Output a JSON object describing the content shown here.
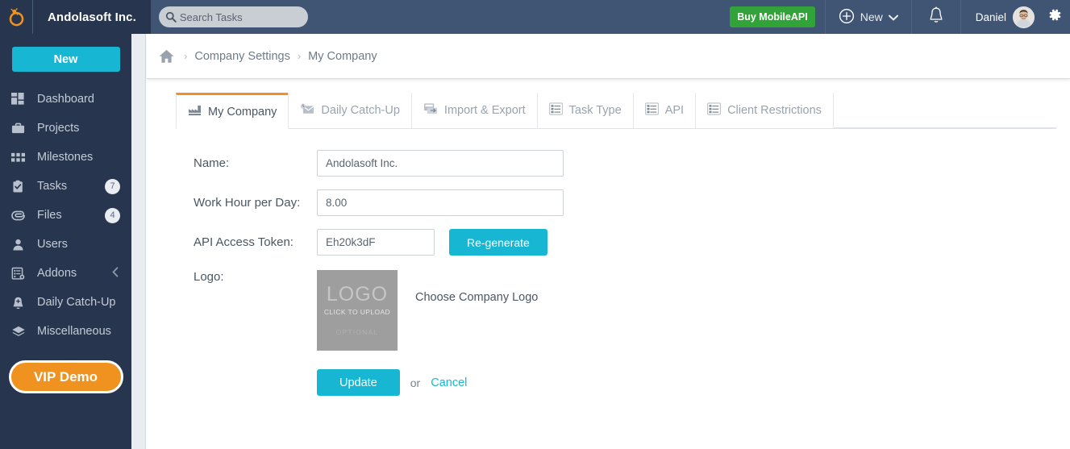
{
  "header": {
    "logo_icon": "orangescrum-logo-icon",
    "brand": "Andolasoft Inc.",
    "search": {
      "placeholder": "Search Tasks",
      "value": "",
      "icon": "search-icon"
    },
    "buy_button": "Buy MobileAPI",
    "new_menu": {
      "label": "New",
      "plus_icon": "plus-circle-icon",
      "caret_icon": "chevron-down-icon"
    },
    "bell_icon": "notification-bell-icon",
    "user_name": "Daniel",
    "avatar_icon": "user-avatar",
    "gear_icon": "settings-gear-icon"
  },
  "sidebar": {
    "new_button": "New",
    "items": [
      {
        "label": "Dashboard",
        "icon": "dashboard-icon",
        "badge": ""
      },
      {
        "label": "Projects",
        "icon": "briefcase-icon",
        "badge": ""
      },
      {
        "label": "Milestones",
        "icon": "grid-icon",
        "badge": ""
      },
      {
        "label": "Tasks",
        "icon": "clipboard-check-icon",
        "badge": "7"
      },
      {
        "label": "Files",
        "icon": "paperclip-icon",
        "badge": ""
      },
      {
        "label": "Users",
        "icon": "person-icon",
        "badge": ""
      },
      {
        "label": "Addons",
        "icon": "addons-icon",
        "badge": ""
      },
      {
        "label": "Daily Catch-Up",
        "icon": "bell-plus-icon",
        "badge": ""
      },
      {
        "label": "Miscellaneous",
        "icon": "layers-icon",
        "badge": ""
      }
    ],
    "files_badge": "4",
    "addons_chevron": "chevron-left-icon",
    "vip_button": "VIP Demo"
  },
  "breadcrumb": {
    "home_icon": "home-icon",
    "separator": "›",
    "items": [
      "Company Settings",
      "My Company"
    ]
  },
  "tabs": [
    {
      "label": "My Company",
      "icon": "factory-icon",
      "active": true
    },
    {
      "label": "Daily Catch-Up",
      "icon": "envelope-clock-icon",
      "active": false
    },
    {
      "label": "Import & Export",
      "icon": "csv-export-icon",
      "active": false
    },
    {
      "label": "Task Type",
      "icon": "list-settings-icon",
      "active": false
    },
    {
      "label": "API",
      "icon": "list-settings-icon",
      "active": false
    },
    {
      "label": "Client Restrictions",
      "icon": "list-settings-icon",
      "active": false
    }
  ],
  "form": {
    "name_label": "Name:",
    "name_value": "Andolasoft Inc.",
    "work_hour_label": "Work Hour per Day:",
    "work_hour_value": "8.00",
    "api_token_label": "API Access Token:",
    "api_token_value": "Eh20k3dF",
    "regenerate_button": "Re-generate",
    "logo_label": "Logo:",
    "logo_placeholder_title": "LOGO",
    "logo_placeholder_sub": "CLICK TO UPLOAD",
    "logo_placeholder_optional": "OPTIONAL",
    "choose_logo": "Choose Company Logo",
    "update_button": "Update",
    "or_text": "or",
    "cancel_link": "Cancel"
  },
  "colors": {
    "header_bg": "#3f5573",
    "sidebar_bg": "#27364e",
    "accent_cyan": "#17b7d4",
    "accent_orange": "#f0921f",
    "buy_green": "#32a338"
  }
}
